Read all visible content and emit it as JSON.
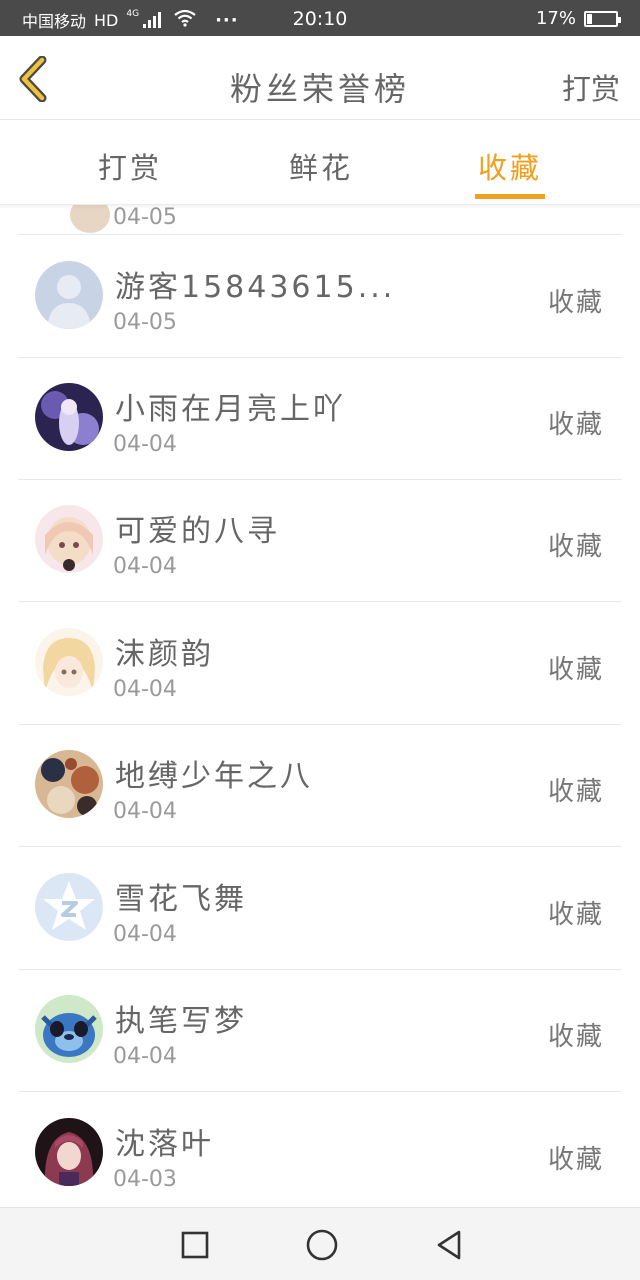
{
  "status_bar": {
    "carrier": "中国移动",
    "hd": "HD",
    "network": "4G",
    "more": "···",
    "time": "20:10",
    "battery": "17%",
    "battery_level": 0.17
  },
  "header": {
    "title": "粉丝荣誉榜",
    "action": "打赏"
  },
  "tabs": [
    {
      "label": "打赏",
      "active": false
    },
    {
      "label": "鲜花",
      "active": false
    },
    {
      "label": "收藏",
      "active": true
    }
  ],
  "accent_color": "#f0a01e",
  "partial_row": {
    "date": "04-05"
  },
  "rows": [
    {
      "name": "游客15843615...",
      "date": "04-05",
      "action": "收藏",
      "avatar": "default-user-avatar"
    },
    {
      "name": "小雨在月亮上吖",
      "date": "04-04",
      "action": "收藏",
      "avatar": "anime-avatar"
    },
    {
      "name": "可爱的八寻",
      "date": "04-04",
      "action": "收藏",
      "avatar": "anime-avatar"
    },
    {
      "name": "沫颜韵",
      "date": "04-04",
      "action": "收藏",
      "avatar": "anime-avatar"
    },
    {
      "name": "地缚少年之八",
      "date": "04-04",
      "action": "收藏",
      "avatar": "anime-avatar"
    },
    {
      "name": "雪花飞舞",
      "date": "04-04",
      "action": "收藏",
      "avatar": "qq-logo-avatar"
    },
    {
      "name": "执笔写梦",
      "date": "04-04",
      "action": "收藏",
      "avatar": "cartoon-avatar"
    },
    {
      "name": "沈落叶",
      "date": "04-03",
      "action": "收藏",
      "avatar": "anime-avatar"
    }
  ]
}
